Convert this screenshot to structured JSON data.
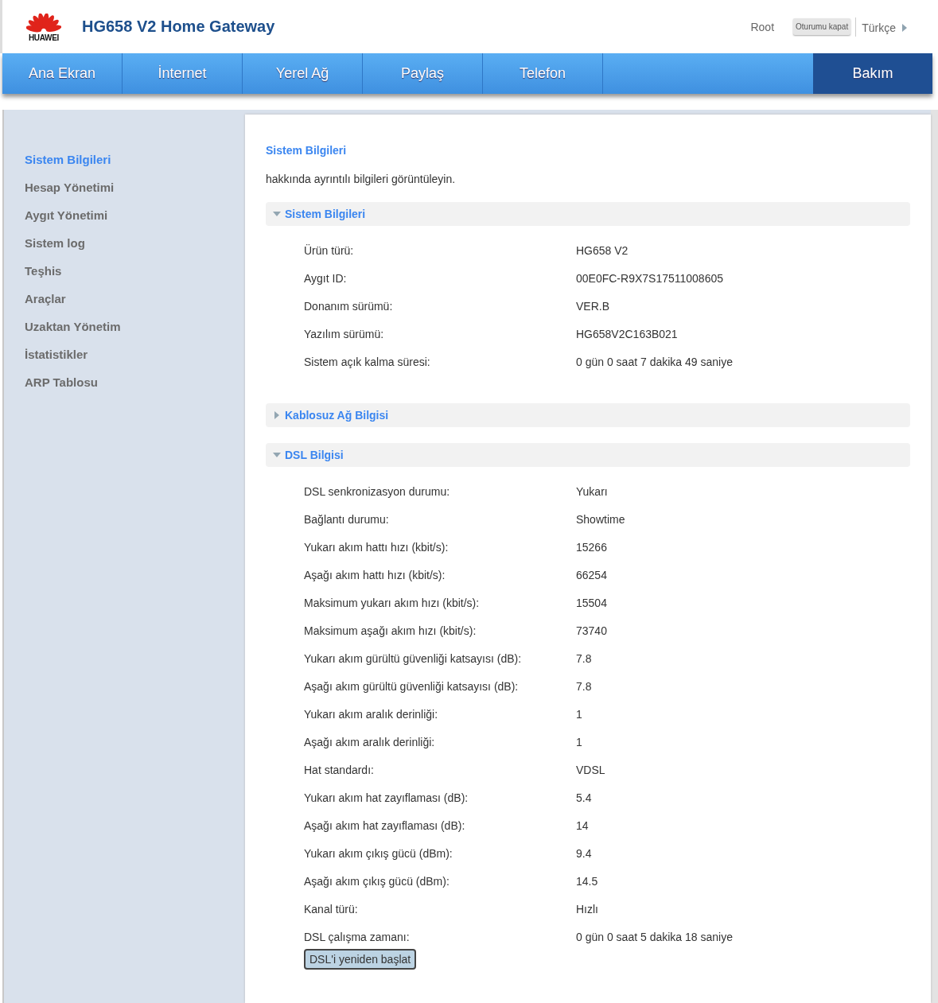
{
  "header": {
    "product": "HG658 V2 Home Gateway",
    "brand": "HUAWEI",
    "user": "Root",
    "logout": "Oturumu kapat",
    "language": "Türkçe"
  },
  "nav": [
    {
      "label": "Ana Ekran",
      "selected": false
    },
    {
      "label": "İnternet",
      "selected": false
    },
    {
      "label": "Yerel Ağ",
      "selected": false
    },
    {
      "label": "Paylaş",
      "selected": false
    },
    {
      "label": "Telefon",
      "selected": false
    },
    {
      "label": "Bakım",
      "selected": true
    }
  ],
  "sidebar": {
    "items": [
      {
        "label": "Sistem Bilgileri",
        "selected": true
      },
      {
        "label": "Hesap Yönetimi",
        "selected": false
      },
      {
        "label": "Aygıt Yönetimi",
        "selected": false
      },
      {
        "label": "Sistem log",
        "selected": false
      },
      {
        "label": "Teşhis",
        "selected": false
      },
      {
        "label": "Araçlar",
        "selected": false
      },
      {
        "label": "Uzaktan Yönetim",
        "selected": false
      },
      {
        "label": "İstatistikler",
        "selected": false
      },
      {
        "label": "ARP Tablosu",
        "selected": false
      }
    ]
  },
  "page": {
    "title": "Sistem Bilgileri",
    "description": "hakkında ayrıntılı bilgileri görüntüleyin."
  },
  "sections": [
    {
      "title": "Sistem Bilgileri",
      "expanded": true,
      "rows": [
        {
          "label": "Ürün türü:",
          "value": "HG658 V2"
        },
        {
          "label": "Aygıt ID:",
          "value": "00E0FC-R9X7S17511008605"
        },
        {
          "label": "Donanım sürümü:",
          "value": "VER.B"
        },
        {
          "label": "Yazılım sürümü:",
          "value": "HG658V2C163B021"
        },
        {
          "label": "Sistem açık kalma süresi:",
          "value": "0 gün 0 saat 7 dakika 49 saniye"
        }
      ]
    },
    {
      "title": "Kablosuz Ağ Bilgisi",
      "expanded": false
    },
    {
      "title": "DSL Bilgisi",
      "expanded": true,
      "rows": [
        {
          "label": "DSL senkronizasyon durumu:",
          "value": "Yukarı"
        },
        {
          "label": "Bağlantı durumu:",
          "value": "Showtime"
        },
        {
          "label": "Yukarı akım hattı hızı (kbit/s):",
          "value": "15266"
        },
        {
          "label": "Aşağı akım hattı hızı (kbit/s):",
          "value": "66254"
        },
        {
          "label": "Maksimum yukarı akım hızı (kbit/s):",
          "value": "15504"
        },
        {
          "label": "Maksimum aşağı akım hızı (kbit/s):",
          "value": "73740"
        },
        {
          "label": "Yukarı akım gürültü güvenliği katsayısı (dB):",
          "value": "7.8"
        },
        {
          "label": "Aşağı akım gürültü güvenliği katsayısı (dB):",
          "value": "7.8"
        },
        {
          "label": "Yukarı akım aralık derinliği:",
          "value": "1"
        },
        {
          "label": "Aşağı akım aralık derinliği:",
          "value": "1"
        },
        {
          "label": "Hat standardı:",
          "value": "VDSL"
        },
        {
          "label": "Yukarı akım hat zayıflaması (dB):",
          "value": "5.4"
        },
        {
          "label": "Aşağı akım hat zayıflaması (dB):",
          "value": "14"
        },
        {
          "label": "Yukarı akım çıkış gücü (dBm):",
          "value": "9.4"
        },
        {
          "label": "Aşağı akım çıkış gücü (dBm):",
          "value": "14.5"
        },
        {
          "label": "Kanal türü:",
          "value": "Hızlı"
        },
        {
          "label": "DSL çalışma zamanı:",
          "value": "0 gün 0 saat 5 dakika 18 saniye"
        }
      ],
      "button": "DSL'i yeniden başlat"
    }
  ]
}
